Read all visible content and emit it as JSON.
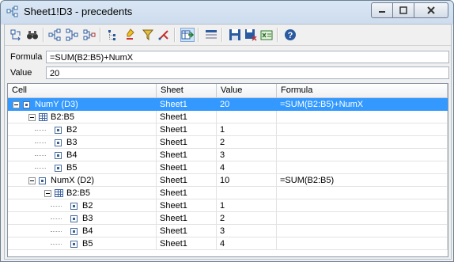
{
  "window": {
    "title": "Sheet1!D3 - precedents"
  },
  "formula_bar": {
    "formula_label": "Formula",
    "formula_value": "=SUM(B2:B5)+NumX",
    "value_label": "Value",
    "value_value": "20"
  },
  "grid": {
    "headers": [
      "Cell",
      "Sheet",
      "Value",
      "Formula"
    ],
    "rows": [
      {
        "cell": "NumY (D3)",
        "sheet": "Sheet1",
        "value": "20",
        "formula": "=SUM(B2:B5)+NumX",
        "level": 0,
        "kind": "cell",
        "expandable": true,
        "selected": true
      },
      {
        "cell": "B2:B5",
        "sheet": "Sheet1",
        "value": "",
        "formula": "",
        "level": 1,
        "kind": "range",
        "expandable": true
      },
      {
        "cell": "B2",
        "sheet": "Sheet1",
        "value": "1",
        "formula": "",
        "level": 2,
        "kind": "cell"
      },
      {
        "cell": "B3",
        "sheet": "Sheet1",
        "value": "2",
        "formula": "",
        "level": 2,
        "kind": "cell"
      },
      {
        "cell": "B4",
        "sheet": "Sheet1",
        "value": "3",
        "formula": "",
        "level": 2,
        "kind": "cell"
      },
      {
        "cell": "B5",
        "sheet": "Sheet1",
        "value": "4",
        "formula": "",
        "level": 2,
        "kind": "cell"
      },
      {
        "cell": "NumX (D2)",
        "sheet": "Sheet1",
        "value": "10",
        "formula": "=SUM(B2:B5)",
        "level": 1,
        "kind": "cell",
        "expandable": true
      },
      {
        "cell": "B2:B5",
        "sheet": "Sheet1",
        "value": "",
        "formula": "",
        "level": 2,
        "kind": "range",
        "expandable": true
      },
      {
        "cell": "B2",
        "sheet": "Sheet1",
        "value": "1",
        "formula": "",
        "level": 3,
        "kind": "cell"
      },
      {
        "cell": "B3",
        "sheet": "Sheet1",
        "value": "2",
        "formula": "",
        "level": 3,
        "kind": "cell"
      },
      {
        "cell": "B4",
        "sheet": "Sheet1",
        "value": "3",
        "formula": "",
        "level": 3,
        "kind": "cell"
      },
      {
        "cell": "B5",
        "sheet": "Sheet1",
        "value": "4",
        "formula": "",
        "level": 3,
        "kind": "cell"
      }
    ]
  },
  "toolbar": {
    "icons": [
      "trace-cell-icon",
      "find-binoculars-icon",
      "precedents-icon",
      "dependents-icon",
      "precedents-dependents-icon",
      "tree-view-icon",
      "highlight-icon",
      "filter-icon",
      "branch-icon",
      "go-to-cell-icon",
      "formula-list-icon",
      "save-icon",
      "save-as-icon",
      "export-excel-icon",
      "help-icon"
    ]
  },
  "colors": {
    "selection": "#3399ff",
    "title_gradient": "#d9e6f4"
  }
}
